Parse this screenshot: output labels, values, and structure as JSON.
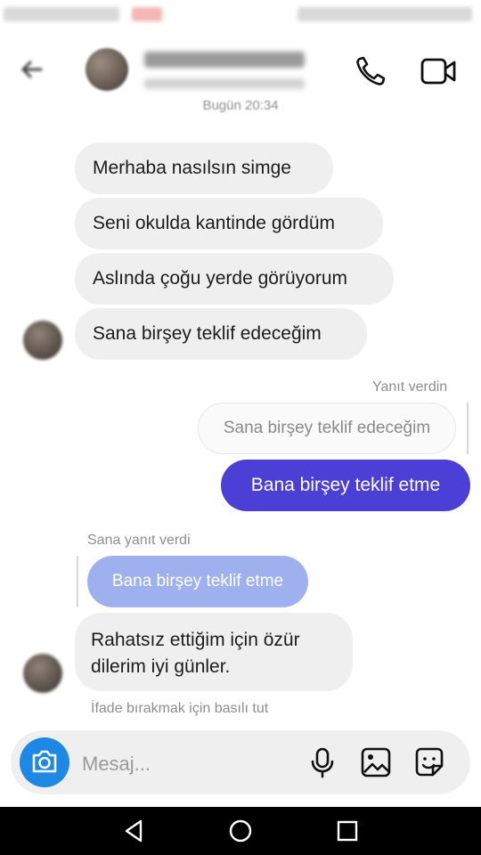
{
  "header": {
    "timestamp": "Bugün 20:34"
  },
  "messages": {
    "incoming": [
      {
        "text": "Merhaba nasılsın simge"
      },
      {
        "text": "Seni okulda kantinde gördüm"
      },
      {
        "text": "Aslında çoğu yerde görüyorum"
      },
      {
        "text": "Sana birşey teklif edeceğim"
      }
    ],
    "reply_label_out": "Yanıt verdin",
    "quoted_out": "Sana birşey teklif edeceğim",
    "outgoing": "Bana birşey teklif etme",
    "reply_label_in": "Sana yanıt verdi",
    "quoted_in": "Bana birşey teklif etme",
    "last_incoming_line1": "Rahatsız ettiğim için özür",
    "last_incoming_line2": "dilerim iyi günler.",
    "hint": "İfade bırakmak için basılı tut"
  },
  "composer": {
    "placeholder": "Mesaj..."
  },
  "colors": {
    "outgoing_bubble": "#4c3fd6",
    "quoted_incoming": "#9fb0ee",
    "camera_button": "#1e88e5"
  },
  "icons": [
    "back-arrow-icon",
    "phone-icon",
    "video-camera-icon",
    "camera-icon",
    "microphone-icon",
    "gallery-icon",
    "sticker-icon",
    "nav-back-icon",
    "nav-home-icon",
    "nav-recents-icon"
  ]
}
